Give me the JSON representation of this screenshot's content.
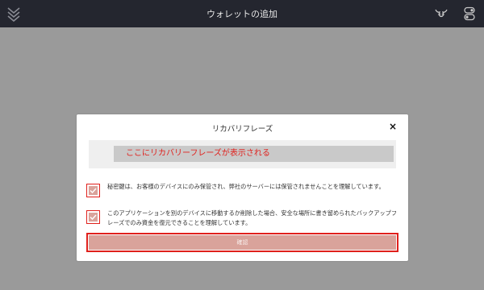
{
  "colors": {
    "header_bg": "#24262f",
    "backdrop": "#9a9a9a",
    "accent_red": "#e0201c",
    "confirm_bg": "#d9a39b",
    "phrase_bg": "#c9c9c9"
  },
  "header": {
    "title": "ウォレットの追加",
    "logo_icon": "chevron-stack-logo",
    "right_icons": [
      "bull-head-icon",
      "toggle-icon"
    ]
  },
  "modal": {
    "title": "リカバリフレーズ",
    "close_icon": "close-icon",
    "close_label": "×",
    "phrase_placeholder": "ここにリカバリーフレーズが表示される",
    "acknowledgements": [
      {
        "checked": true,
        "text": "秘密鍵は、お客様のデバイスにのみ保管され、弊社のサーバーには保管されませんことを理解しています。"
      },
      {
        "checked": true,
        "text": "このアプリケーションを別のデバイスに移動するか削除した場合、安全な場所に書き留められたバックアップフレーズでのみ資金を復元できることを理解しています。"
      }
    ],
    "confirm_label": "確認"
  }
}
